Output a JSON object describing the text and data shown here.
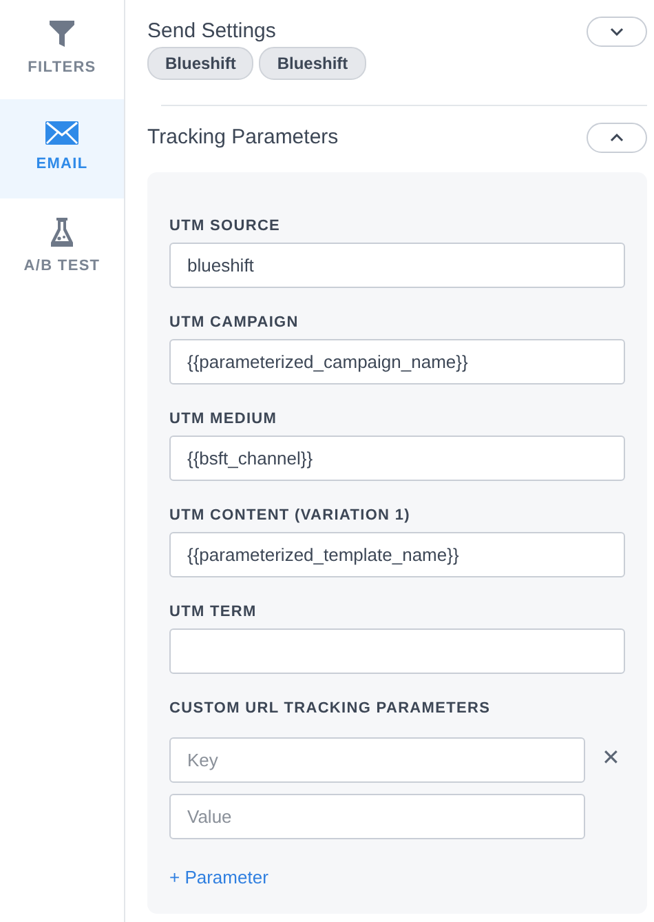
{
  "sidebar": {
    "items": [
      {
        "label": "FILTERS",
        "selected": false
      },
      {
        "label": "EMAIL",
        "selected": true
      },
      {
        "label": "A/B TEST",
        "selected": false
      }
    ]
  },
  "sections": [
    {
      "title": "Send Settings",
      "expanded": false,
      "tags": [
        "Blueshift",
        "Blueshift"
      ]
    },
    {
      "title": "Tracking Parameters",
      "expanded": true,
      "fields": [
        {
          "label": "UTM SOURCE",
          "value": "blueshift"
        },
        {
          "label": "UTM CAMPAIGN",
          "value": "{{parameterized_campaign_name}}"
        },
        {
          "label": "UTM MEDIUM",
          "value": "{{bsft_channel}}"
        },
        {
          "label": "UTM CONTENT (VARIATION 1)",
          "value": "{{parameterized_template_name}}"
        },
        {
          "label": "UTM TERM"
        }
      ],
      "custom": {
        "label": "CUSTOM URL TRACKING PARAMETERS",
        "key_placeholder": "Key",
        "value_placeholder": "Value",
        "remove": "✕",
        "add": "+ Parameter"
      }
    }
  ]
}
